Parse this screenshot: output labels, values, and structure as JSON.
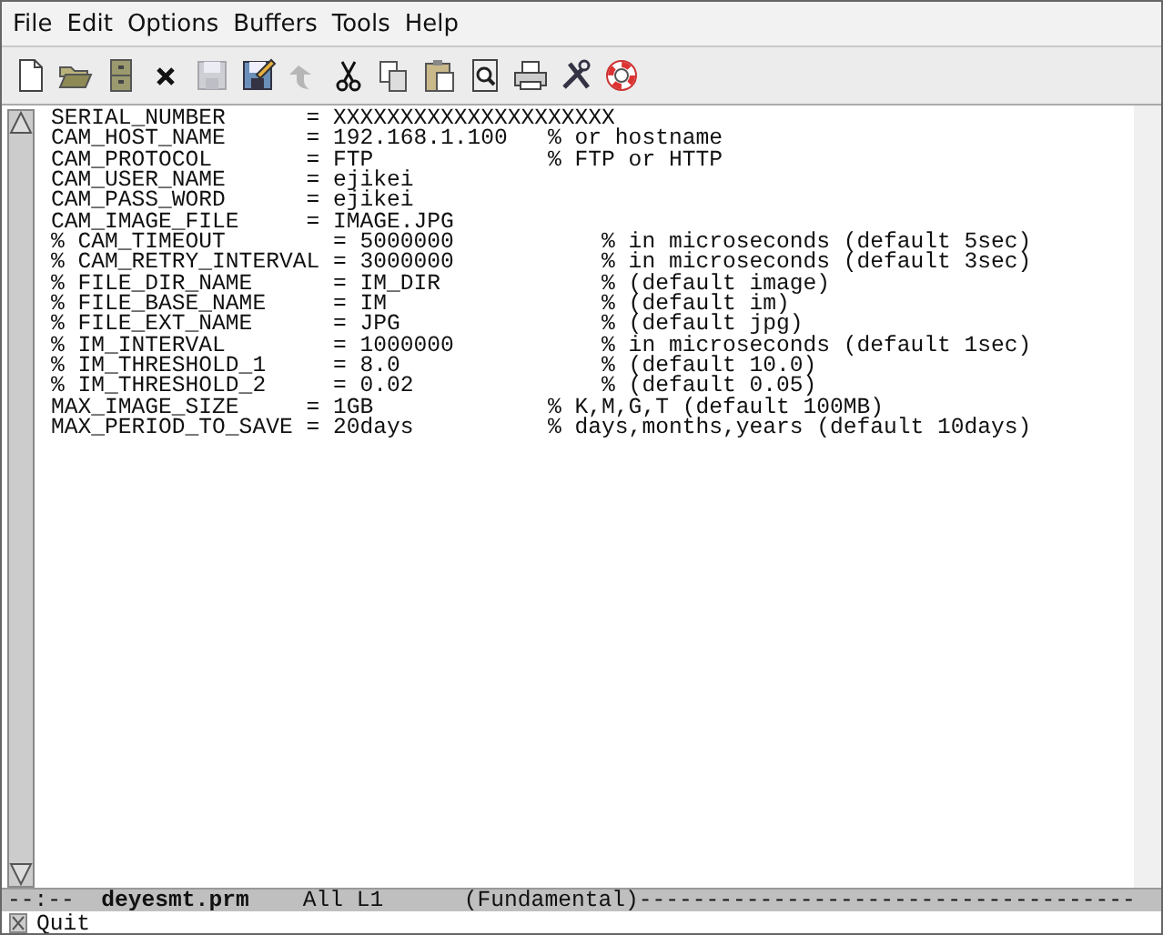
{
  "menu": [
    "File",
    "Edit",
    "Options",
    "Buffers",
    "Tools",
    "Help"
  ],
  "toolbar": [
    {
      "kind": "new",
      "disabled": false
    },
    {
      "kind": "open",
      "disabled": false
    },
    {
      "kind": "cabinet",
      "disabled": false
    },
    {
      "kind": "close",
      "disabled": false
    },
    {
      "kind": "save",
      "disabled": true
    },
    {
      "kind": "saveas",
      "disabled": false
    },
    {
      "kind": "undo",
      "disabled": true
    },
    {
      "kind": "cut",
      "disabled": false
    },
    {
      "kind": "copy",
      "disabled": false
    },
    {
      "kind": "paste",
      "disabled": false
    },
    {
      "kind": "search",
      "disabled": false
    },
    {
      "kind": "print",
      "disabled": false
    },
    {
      "kind": "tools",
      "disabled": false
    },
    {
      "kind": "help",
      "disabled": false
    }
  ],
  "buffer": {
    "lines": [
      "SERIAL_NUMBER      = XXXXXXXXXXXXXXXXXXXXX",
      "CAM_HOST_NAME      = 192.168.1.100   % or hostname",
      "CAM_PROTOCOL       = FTP             % FTP or HTTP",
      "CAM_USER_NAME      = ejikei",
      "CAM_PASS_WORD      = ejikei",
      "CAM_IMAGE_FILE     = IMAGE.JPG",
      "% CAM_TIMEOUT        = 5000000           % in microseconds (default 5sec)",
      "% CAM_RETRY_INTERVAL = 3000000           % in microseconds (default 3sec)",
      "% FILE_DIR_NAME      = IM_DIR            % (default image)",
      "% FILE_BASE_NAME     = IM                % (default im)",
      "% FILE_EXT_NAME      = JPG               % (default jpg)",
      "% IM_INTERVAL        = 1000000           % in microseconds (default 1sec)",
      "% IM_THRESHOLD_1     = 8.0               % (default 10.0)",
      "% IM_THRESHOLD_2     = 0.02              % (default 0.05)",
      "MAX_IMAGE_SIZE     = 1GB             % K,M,G,T (default 100MB)",
      "MAX_PERIOD_TO_SAVE = 20days          % days,months,years (default 10days)"
    ]
  },
  "mode_line": "--:--  **deyesmt.prm**    All L1      (Fundamental)-------------------------------------",
  "minibuffer": "Quit"
}
